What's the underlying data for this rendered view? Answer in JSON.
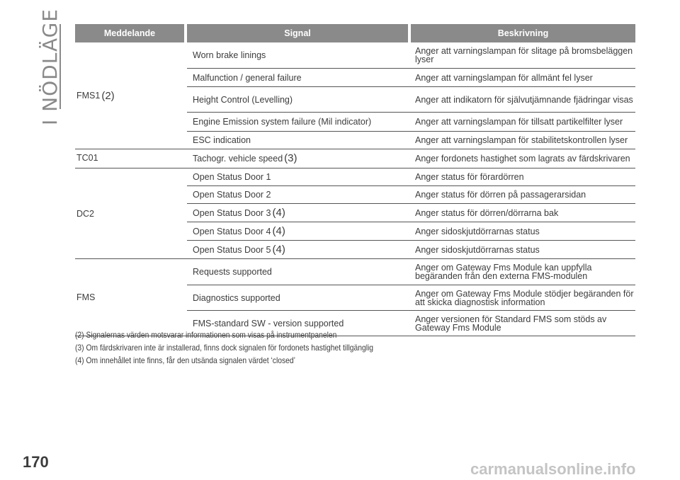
{
  "section_title": "I NÖDLÄGE",
  "page_number": "170",
  "watermark": "carmanualsonline.info",
  "table": {
    "headers": [
      "Meddelande",
      "Signal",
      "Beskrivning"
    ],
    "groups": [
      {
        "message": "FMS1",
        "message_ref": "(2)",
        "rows": [
          {
            "signal": "Worn brake linings",
            "signal_ref": "",
            "description": "Anger att varningslampan för slitage på bromsbeläggen lyser"
          },
          {
            "signal": "Malfunction / general failure",
            "signal_ref": "",
            "description": "Anger att varningslampan för allmänt fel lyser"
          },
          {
            "signal": "Height Control (Levelling)",
            "signal_ref": "",
            "description": "Anger att indikatorn för självutjämnande fjädringar visas"
          },
          {
            "signal": "Engine Emission system failure (Mil indicator)",
            "signal_ref": "",
            "description": "Anger att varningslampan för tillsatt partikelfilter lyser"
          },
          {
            "signal": "ESC indication",
            "signal_ref": "",
            "description": "Anger att varningslampan för stabilitetskontrollen lyser"
          }
        ]
      },
      {
        "message": "TC01",
        "message_ref": "",
        "rows": [
          {
            "signal": "Tachogr. vehicle speed",
            "signal_ref": "(3)",
            "description": "Anger fordonets hastighet som lagrats av färdskrivaren"
          }
        ]
      },
      {
        "message": "DC2",
        "message_ref": "",
        "rows": [
          {
            "signal": "Open Status Door 1",
            "signal_ref": "",
            "description": "Anger status för förardörren"
          },
          {
            "signal": "Open Status Door 2",
            "signal_ref": "",
            "description": "Anger status för dörren på passagerarsidan"
          },
          {
            "signal": "Open Status Door 3",
            "signal_ref": "(4)",
            "description": "Anger status för dörren/dörrarna bak"
          },
          {
            "signal": "Open Status Door 4",
            "signal_ref": "(4)",
            "description": "Anger sidoskjutdörrarnas status"
          },
          {
            "signal": "Open Status Door 5",
            "signal_ref": "(4)",
            "description": "Anger sidoskjutdörrarnas status"
          }
        ]
      },
      {
        "message": "FMS",
        "message_ref": "",
        "rows": [
          {
            "signal": "Requests supported",
            "signal_ref": "",
            "description": "Anger om Gateway Fms Module kan uppfylla begäranden från den externa FMS-modulen"
          },
          {
            "signal": "Diagnostics supported",
            "signal_ref": "",
            "description": "Anger om Gateway Fms Module stödjer begäranden för att skicka diagnostisk information"
          },
          {
            "signal": "FMS-standard SW - version supported",
            "signal_ref": "",
            "description": "Anger versionen för Standard FMS som stöds av Gateway Fms Module"
          }
        ]
      }
    ]
  },
  "footnotes": [
    "(2) Signalernas värden motsvarar informationen som visas på instrumentpanelen",
    "(3) Om färdskrivaren inte är installerad, finns dock signalen för fordonets hastighet tillgänglig",
    "(4) Om innehållet inte finns, får den utsända signalen värdet ‘closed’"
  ]
}
